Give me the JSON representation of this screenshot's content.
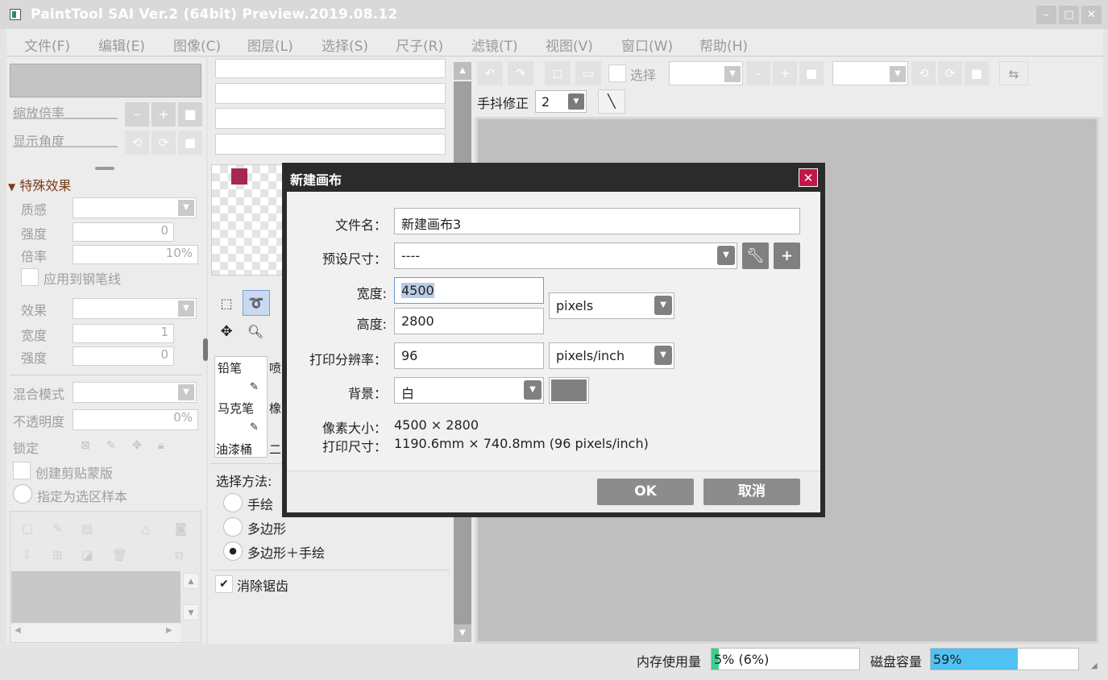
{
  "app": {
    "title": "PaintTool SAI Ver.2 (64bit) Preview.2019.08.12",
    "window_buttons": {
      "minimize": "–",
      "maximize": "□",
      "close": "✕"
    }
  },
  "menu": [
    "文件(F)",
    "编辑(E)",
    "图像(C)",
    "图层(L)",
    "选择(S)",
    "尺子(R)",
    "滤镜(T)",
    "视图(V)",
    "窗口(W)",
    "帮助(H)"
  ],
  "nav": {
    "zoom_label": "缩放倍率",
    "angle_label": "显示角度"
  },
  "effects": {
    "header": "特殊效果",
    "texture_label": "质感",
    "strength_label": "强度",
    "strength_value": "0",
    "rate_label": "倍率",
    "rate_value": "10%",
    "apply_pen_label": "应用到钢笔线",
    "effect_label": "效果",
    "width_label": "宽度",
    "width_value": "1",
    "strength2_label": "强度",
    "strength2_value": "0"
  },
  "layer_props": {
    "blend_label": "混合模式",
    "opacity_label": "不透明度",
    "opacity_value": "0%",
    "lock_label": "锁定",
    "clip_label": "创建剪贴蒙版",
    "sample_label": "指定为选区样本"
  },
  "tools": {
    "brushes": [
      {
        "name": "铅笔",
        "col2": "喷"
      },
      {
        "name": "马克笔",
        "col2": "橡"
      },
      {
        "name": "油漆桶",
        "col2": "二"
      }
    ],
    "select_method_label": "选择方法:",
    "methods": [
      "手绘",
      "多边形",
      "多边形＋手绘"
    ],
    "selected_method": "多边形＋手绘",
    "antialias_label": "消除锯齿",
    "antialias_checked": "✔",
    "primary_color": "#a52a52"
  },
  "toolbar": {
    "select_label": "选择",
    "stabilizer_label": "手抖修正",
    "stabilizer_value": "2"
  },
  "dialog": {
    "title": "新建画布",
    "close": "✕",
    "filename_label": "文件名：",
    "filename_value": "新建画布3",
    "preset_label": "预设尺寸：",
    "preset_value": "----",
    "width_label": "宽度:",
    "width_value": "4500",
    "height_label": "高度:",
    "height_value": "2800",
    "unit_value": "pixels",
    "dpi_label": "打印分辨率：",
    "dpi_value": "96",
    "dpi_unit": "pixels/inch",
    "bg_label": "背景：",
    "bg_value": "白",
    "bg_swatch": "#808080",
    "pixel_size_label": "像素大小：",
    "pixel_size_value": "4500 × 2800",
    "print_size_label": "打印尺寸：",
    "print_size_value": "1190.6mm × 740.8mm (96 pixels/inch)",
    "ok_label": "OK",
    "cancel_label": "取消"
  },
  "status": {
    "memory_label": "内存使用量",
    "memory_value": "5% (6%)",
    "memory_fraction": 0.05,
    "disk_label": "磁盘容量",
    "disk_value": "59%",
    "disk_fraction": 0.59,
    "memory_color": "#3ccf8e",
    "disk_color": "#4fc1f2"
  }
}
